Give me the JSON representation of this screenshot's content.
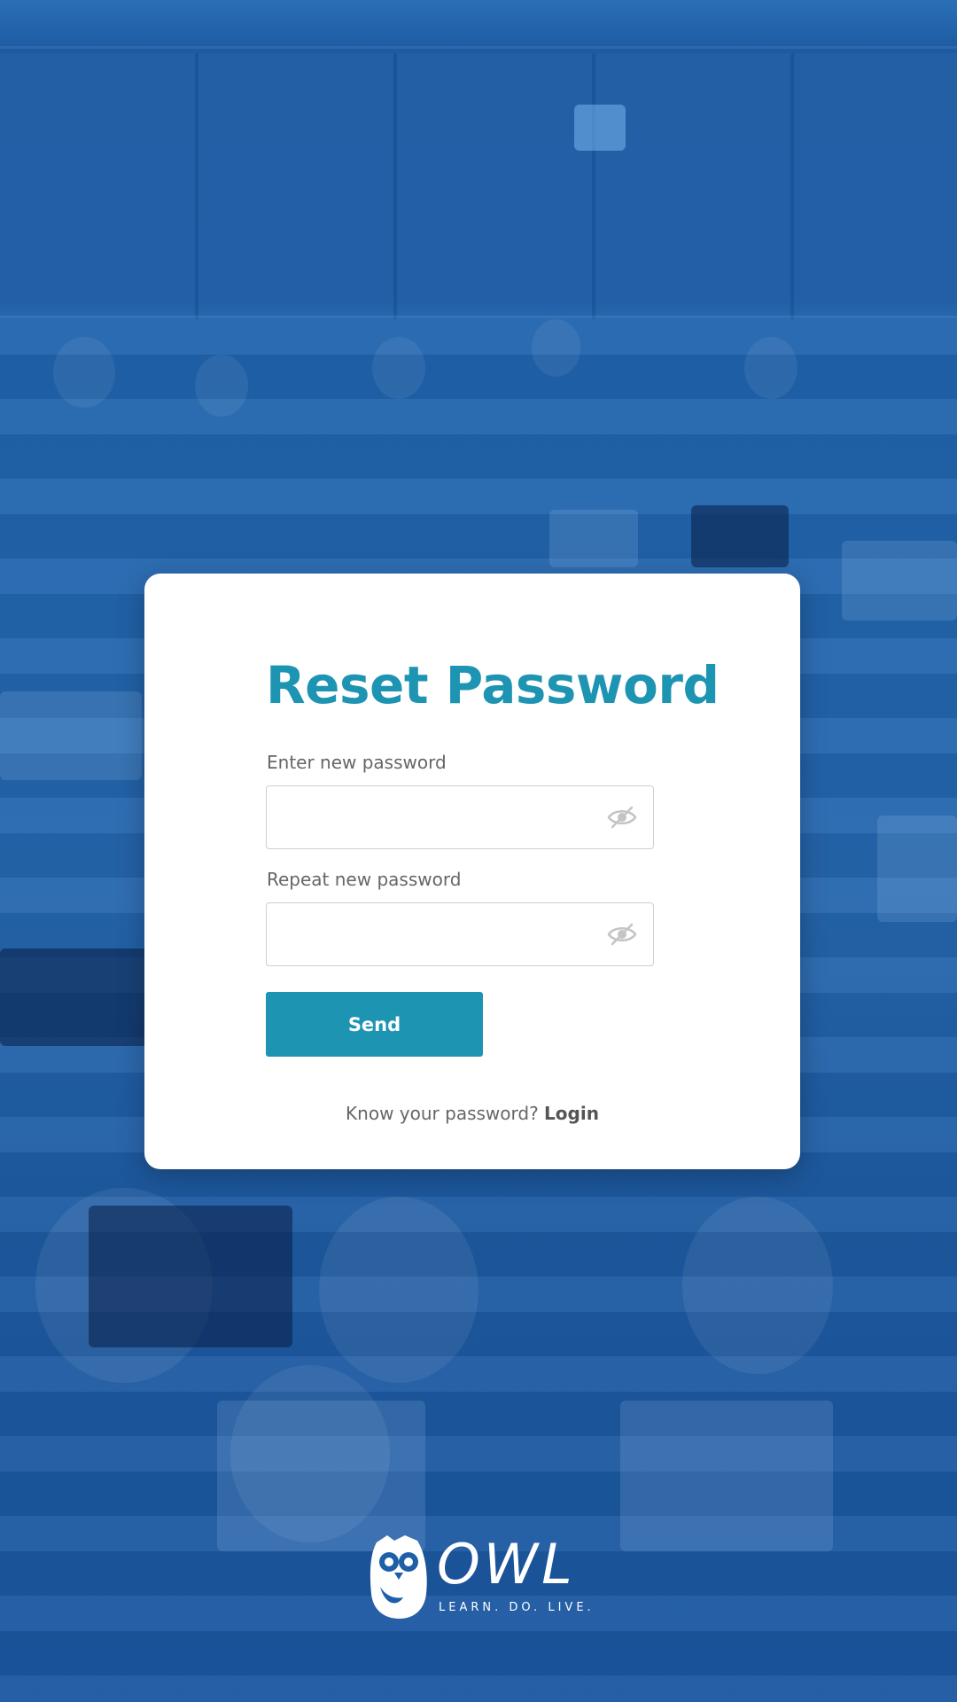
{
  "colors": {
    "accent": "#1e94b3",
    "card_background": "#ffffff",
    "label_text": "#666666",
    "background_tint": "#1d5fa8"
  },
  "form": {
    "title": "Reset Password",
    "new_password": {
      "label": "Enter new password",
      "value": "",
      "icon": "eye-slash-icon"
    },
    "repeat_password": {
      "label": "Repeat new password",
      "value": "",
      "icon": "eye-slash-icon"
    },
    "submit_label": "Send",
    "footer_prompt": "Know your password?",
    "footer_link": "Login"
  },
  "brand": {
    "logo_icon": "owl-icon",
    "name": "OWL",
    "tagline": "LEARN. DO. LIVE."
  }
}
